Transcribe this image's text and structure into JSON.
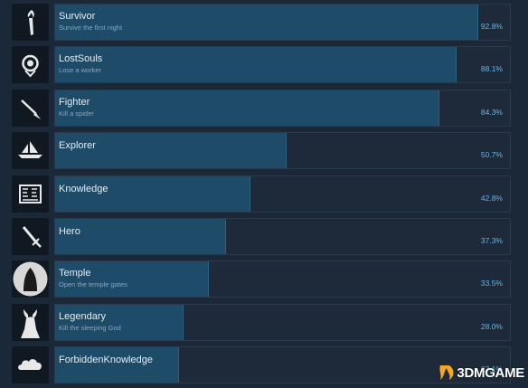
{
  "achievements": [
    {
      "name": "Survivor",
      "description": "Survive the first night",
      "percent_text": "92.8%",
      "percent": 92.8,
      "icon": "torch-icon"
    },
    {
      "name": "LostSouls",
      "description": "Lose a worker",
      "percent_text": "88.1%",
      "percent": 88.1,
      "icon": "ghost-face-icon"
    },
    {
      "name": "Fighter",
      "description": "Kill a spider",
      "percent_text": "84.3%",
      "percent": 84.3,
      "icon": "spear-icon"
    },
    {
      "name": "Explorer",
      "description": "",
      "percent_text": "50.7%",
      "percent": 50.7,
      "icon": "boat-icon"
    },
    {
      "name": "Knowledge",
      "description": "",
      "percent_text": "42.8%",
      "percent": 42.8,
      "icon": "scroll-icon"
    },
    {
      "name": "Hero",
      "description": "",
      "percent_text": "37.3%",
      "percent": 37.3,
      "icon": "sword-icon"
    },
    {
      "name": "Temple",
      "description": "Open the temple gates",
      "percent_text": "33.5%",
      "percent": 33.5,
      "icon": "temple-icon"
    },
    {
      "name": "Legendary",
      "description": "Kill the sleeping God",
      "percent_text": "28.0%",
      "percent": 28.0,
      "icon": "horned-god-icon"
    },
    {
      "name": "ForbiddenKnowledge",
      "description": "",
      "percent_text": "27.1%",
      "percent": 27.1,
      "icon": "cloud-icon"
    }
  ],
  "watermark": {
    "text": "3DMGAME"
  },
  "colors": {
    "background": "#1b2838",
    "bar_fill": "#1e4b68",
    "percent_text": "#5fb7ee"
  }
}
